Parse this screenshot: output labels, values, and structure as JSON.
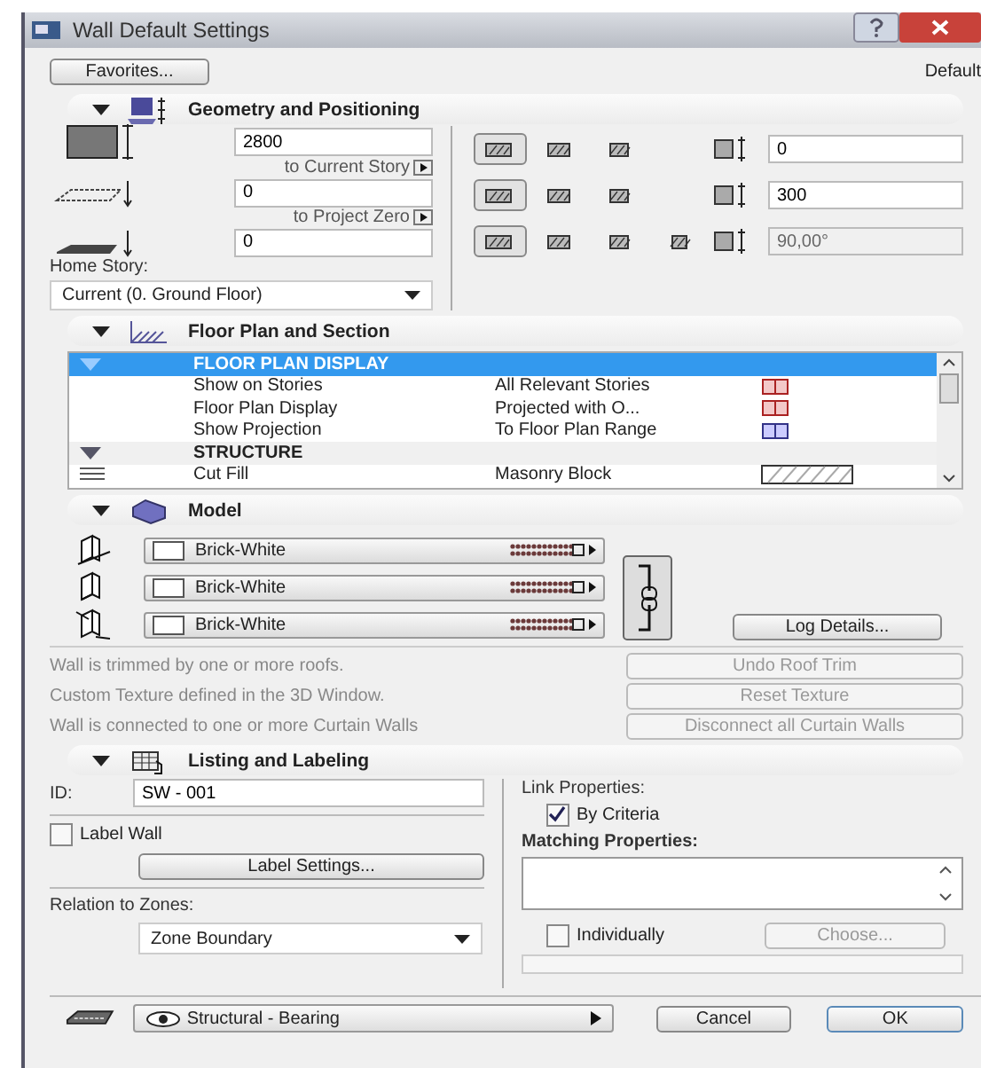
{
  "window": {
    "title": "Wall Default Settings"
  },
  "favorites_button": "Favorites...",
  "default_label": "Default",
  "geometry": {
    "title": "Geometry and Positioning",
    "expanded": true,
    "top_value": "2800",
    "top_link": "to Current Story",
    "bottom_value": "0",
    "bottom_link": "to Project Zero",
    "base_value": "0",
    "home_story_label": "Home Story:",
    "home_story_value": "Current (0. Ground Floor)",
    "option_rows": [
      {
        "options": [
          {
            "selected": true
          },
          {
            "selected": false
          },
          {
            "selected": false
          }
        ]
      },
      {
        "options": [
          {
            "selected": true
          },
          {
            "selected": false
          },
          {
            "selected": false
          }
        ]
      },
      {
        "options": [
          {
            "selected": true
          },
          {
            "selected": false
          },
          {
            "selected": false
          },
          {
            "selected": false
          }
        ]
      }
    ],
    "fields": [
      {
        "value": "0",
        "disabled": false
      },
      {
        "value": "300",
        "disabled": false
      },
      {
        "value": "90,00°",
        "disabled": true
      }
    ]
  },
  "floor_plan": {
    "title": "Floor Plan and Section",
    "expanded": true,
    "rows": [
      {
        "kind": "group",
        "label": "FLOOR PLAN DISPLAY",
        "expanded": true,
        "selected": true
      },
      {
        "kind": "item",
        "label": "Show on Stories",
        "value": "All Relevant Stories",
        "selected": false
      },
      {
        "kind": "item",
        "label": "Floor Plan Display",
        "value": "Projected with O...",
        "selected": false
      },
      {
        "kind": "item",
        "label": "Show Projection",
        "value": "To Floor Plan Range",
        "selected": false
      },
      {
        "kind": "group",
        "label": "STRUCTURE",
        "expanded": true,
        "selected": false
      },
      {
        "kind": "fill",
        "label": "Cut Fill",
        "value": "Masonry Block",
        "selected": false
      }
    ]
  },
  "model": {
    "title": "Model",
    "expanded": true,
    "surfaces": [
      {
        "name": "Brick-White"
      },
      {
        "name": "Brick-White"
      },
      {
        "name": "Brick-White"
      }
    ],
    "chain_linked": true,
    "log_button": "Log Details...",
    "notes": [
      {
        "text": "Wall is trimmed by one or more roofs.",
        "button": "Undo Roof Trim",
        "disabled": true
      },
      {
        "text": "Custom Texture defined in the 3D Window.",
        "button": "Reset Texture",
        "disabled": true
      },
      {
        "text": "Wall is connected to one or more Curtain Walls",
        "button": "Disconnect all Curtain Walls",
        "disabled": true
      }
    ]
  },
  "listing": {
    "title": "Listing and Labeling",
    "expanded": true,
    "id_label": "ID:",
    "id_value": "SW - 001",
    "label_wall": {
      "label": "Label Wall",
      "checked": false
    },
    "label_settings_button": "Label Settings...",
    "relation_label": "Relation to Zones:",
    "relation_value": "Zone Boundary",
    "link_label": "Link Properties:",
    "by_criteria": {
      "label": "By Criteria",
      "checked": true
    },
    "matching_label": "Matching Properties:",
    "individually": {
      "label": "Individually",
      "checked": false
    },
    "choose_button": {
      "label": "Choose...",
      "disabled": true
    }
  },
  "footer": {
    "layer": "Structural - Bearing",
    "cancel": "Cancel",
    "ok": "OK"
  }
}
